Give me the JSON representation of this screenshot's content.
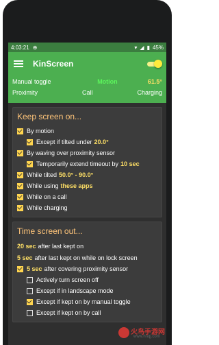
{
  "status_bar": {
    "time": "4:03:21",
    "battery": "45%"
  },
  "app": {
    "title": "KinScreen"
  },
  "sensor": {
    "manual_toggle": "Manual toggle",
    "motion": "Motion",
    "angle": "61.5°",
    "proximity": "Proximity",
    "call": "Call",
    "charging": "Charging"
  },
  "keep": {
    "title": "Keep screen on...",
    "by_motion": "By motion",
    "except_prefix": "Except if tilted under",
    "except_value": "20.0°",
    "by_waving": "By waving over proximity sensor",
    "temp_prefix": "Temporarily extend timeout by",
    "temp_value": "10 sec",
    "tilted_prefix": "While tilted",
    "tilted_value": "50.0° - 90.0°",
    "using_prefix": "While using",
    "using_value": "these apps",
    "on_call": "While on a call",
    "charging": "While charging"
  },
  "timeout": {
    "title": "Time screen out...",
    "l1_value": "20 sec",
    "l1_text": "after last kept on",
    "l2_value": "5 sec",
    "l2_text": "after last kept on while on lock screen",
    "l3_value": "5 sec",
    "l3_text": "after covering proximity sensor",
    "actively": "Actively turn screen off",
    "landscape": "Except if in landscape mode",
    "manual": "Except if kept on by manual toggle",
    "call": "Except if kept on by call"
  },
  "watermark": {
    "text": "火鸟手游网",
    "url": "www.hnqj.com"
  },
  "colors": {
    "accent": "#4caf50",
    "highlight": "#ffe066",
    "header": "#ffc57a"
  }
}
